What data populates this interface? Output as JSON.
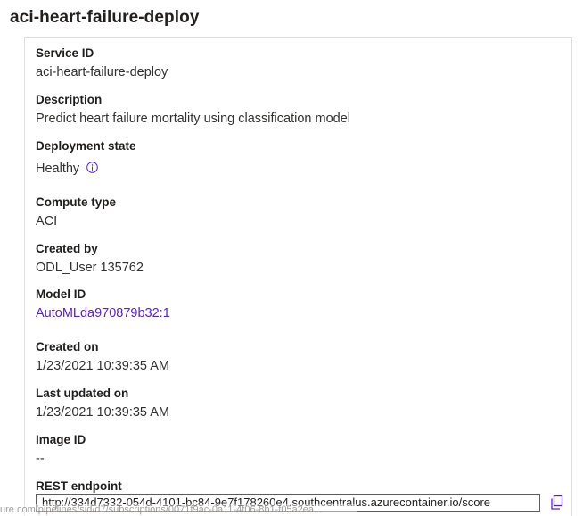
{
  "header": {
    "title": "aci-heart-failure-deploy"
  },
  "details": {
    "service_id": {
      "label": "Service ID",
      "value": "aci-heart-failure-deploy"
    },
    "description": {
      "label": "Description",
      "value": "Predict heart failure mortality using classification model"
    },
    "deployment_state": {
      "label": "Deployment state",
      "value": "Healthy",
      "icon": "info-icon"
    },
    "compute_type": {
      "label": "Compute type",
      "value": "ACI"
    },
    "created_by": {
      "label": "Created by",
      "value": "ODL_User 135762"
    },
    "model_id": {
      "label": "Model ID",
      "value": "AutoMLda970879b32:1"
    },
    "created_on": {
      "label": "Created on",
      "value": "1/23/2021 10:39:35 AM"
    },
    "last_updated_on": {
      "label": "Last updated on",
      "value": "1/23/2021 10:39:35 AM"
    },
    "image_id": {
      "label": "Image ID",
      "value": "--"
    },
    "rest_endpoint": {
      "label": "REST endpoint",
      "value": "http://334d7332-054d-4101-bc84-9e7f178260e4.southcentralus.azurecontainer.io/score",
      "copy_icon": "copy-icon"
    }
  },
  "status_bar": {
    "text": "ure.com/pipelines/sid/d7/subscriptions/0071f9ac-0a11-4f06-8b1-f05a2ea..."
  },
  "colors": {
    "link": "#5b22c4",
    "text": "#201f1e",
    "border": "#e1dfdd"
  }
}
